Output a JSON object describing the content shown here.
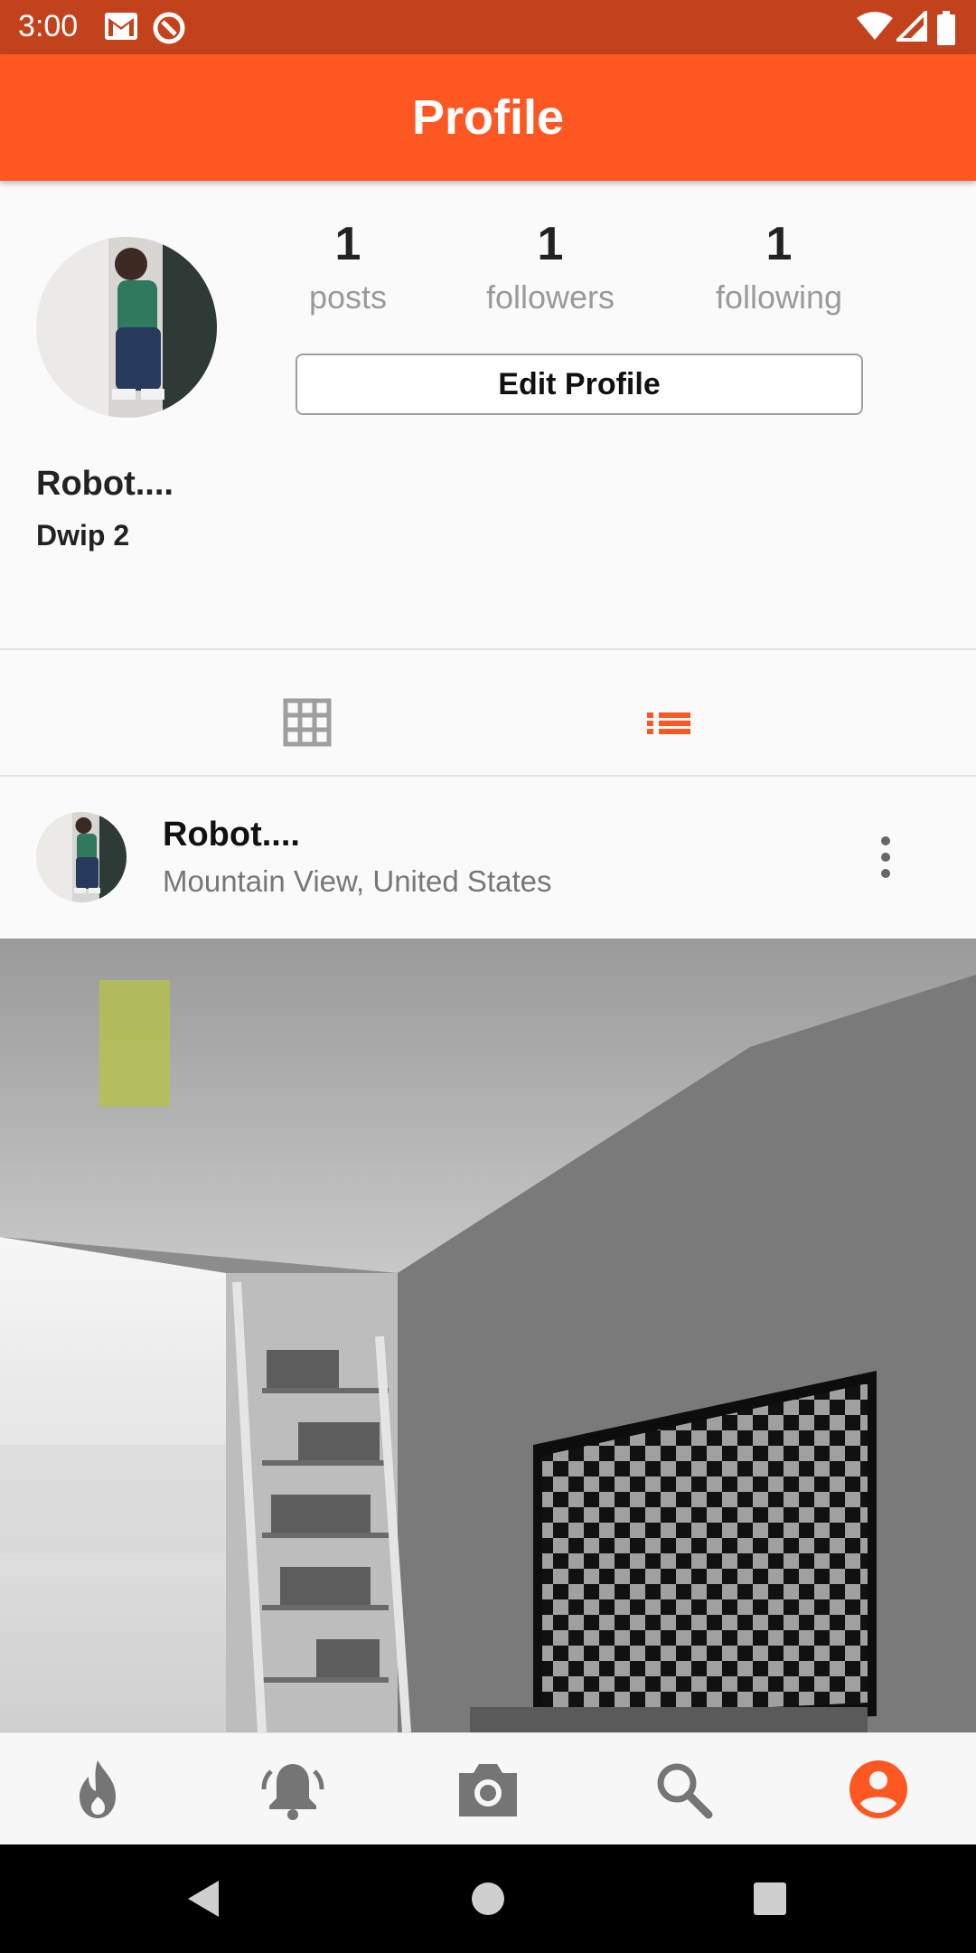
{
  "status_bar": {
    "time": "3:00",
    "icons": [
      "gmail-icon",
      "sync-icon",
      "wifi-icon",
      "signal-icon",
      "battery-icon"
    ],
    "background": "#c3421b"
  },
  "app_bar": {
    "title": "Profile",
    "background": "#ff5722"
  },
  "profile": {
    "username": "Robot....",
    "bio": "Dwip 2",
    "stats": [
      {
        "value": "1",
        "label": "posts"
      },
      {
        "value": "1",
        "label": "followers"
      },
      {
        "value": "1",
        "label": "following"
      }
    ],
    "edit_button_label": "Edit Profile"
  },
  "view_toggle": {
    "options": [
      "grid-view-icon",
      "list-view-icon"
    ],
    "selected": "list-view-icon",
    "active_color": "#ff5722",
    "inactive_color": "#9e9e9e"
  },
  "post": {
    "username": "Robot....",
    "location": "Mountain View, United States",
    "menu_icon": "more-vert-icon"
  },
  "bottom_nav": {
    "items": [
      "fire-icon",
      "bell-icon",
      "camera-icon",
      "search-icon",
      "account-icon"
    ],
    "selected": "account-icon",
    "active_color": "#ff5722",
    "inactive_color": "#757575"
  },
  "system_nav": {
    "buttons": [
      "back-icon",
      "home-icon",
      "recents-icon"
    ]
  }
}
